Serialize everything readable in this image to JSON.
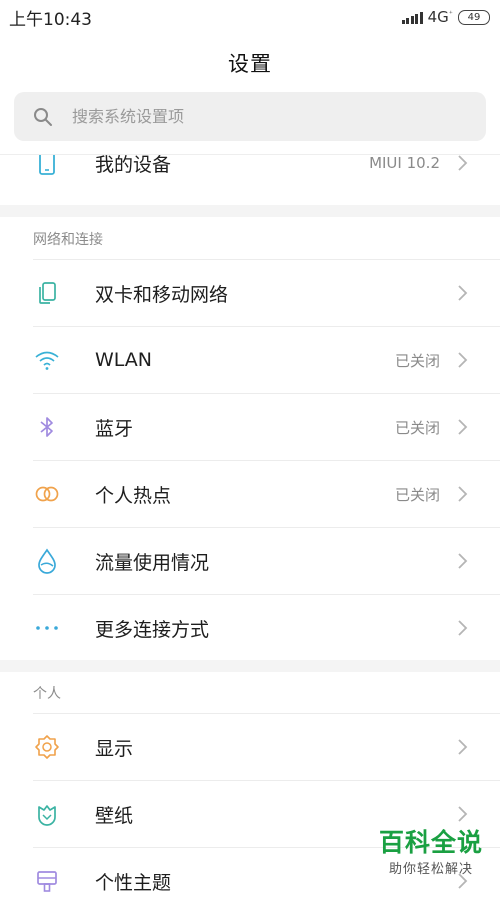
{
  "status": {
    "time": "上午10:43",
    "network": "4G",
    "network_sub": "⁺",
    "battery": "49"
  },
  "header": {
    "title": "设置"
  },
  "search": {
    "placeholder": "搜索系统设置项"
  },
  "top_item": {
    "label": "我的设备",
    "value": "MIUI 10.2",
    "icon": "phone-icon"
  },
  "sections": [
    {
      "header": "网络和连接",
      "items": [
        {
          "label": "双卡和移动网络",
          "value": "",
          "icon": "sim-cards-icon"
        },
        {
          "label": "WLAN",
          "value": "已关闭",
          "icon": "wifi-icon"
        },
        {
          "label": "蓝牙",
          "value": "已关闭",
          "icon": "bluetooth-icon"
        },
        {
          "label": "个人热点",
          "value": "已关闭",
          "icon": "hotspot-icon"
        },
        {
          "label": "流量使用情况",
          "value": "",
          "icon": "data-usage-icon"
        },
        {
          "label": "更多连接方式",
          "value": "",
          "icon": "more-dots-icon"
        }
      ]
    },
    {
      "header": "个人",
      "items": [
        {
          "label": "显示",
          "value": "",
          "icon": "display-sun-icon"
        },
        {
          "label": "壁纸",
          "value": "",
          "icon": "wallpaper-icon"
        },
        {
          "label": "个性主题",
          "value": "",
          "icon": "theme-icon"
        }
      ]
    }
  ],
  "colors": {
    "teal": "#3bb3a3",
    "wifi": "#39b1d6",
    "bluetooth": "#a08be0",
    "hotspot": "#f0a24b",
    "data": "#3aa9d9",
    "more": "#3aa9d9",
    "display": "#f0a24b",
    "wallpaper": "#3bb3a3",
    "theme": "#a08be0"
  },
  "watermark": {
    "main": "百科全说",
    "sub": "助你轻松解决"
  }
}
